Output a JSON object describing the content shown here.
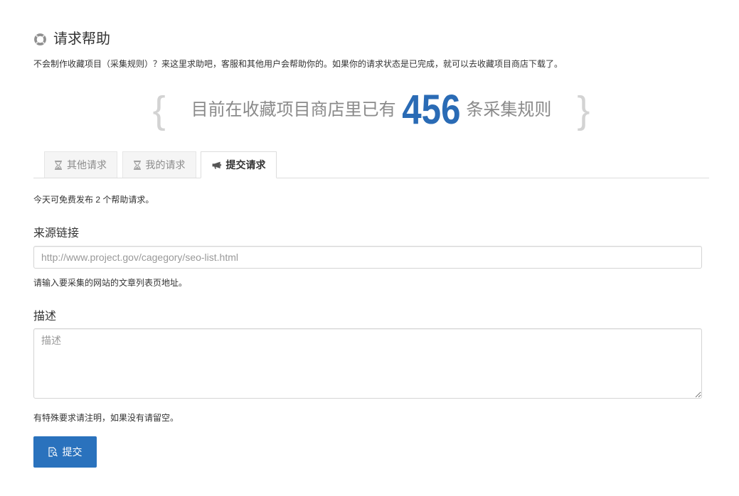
{
  "header": {
    "title": "请求帮助",
    "icon": "lifebuoy-icon",
    "description": "不会制作收藏项目（采集规则）？来这里求助吧，客服和其他用户会帮助你的。如果你的请求状态是已完成，就可以去收藏项目商店下载了。"
  },
  "banner": {
    "open_brace": "{",
    "prefix": "目前在收藏项目商店里已有",
    "count": 456,
    "suffix": "条采集规则",
    "close_brace": "}",
    "count_color": "#2a6bb5"
  },
  "tabs": [
    {
      "label": "其他请求",
      "icon": "hourglass-icon",
      "active": false
    },
    {
      "label": "我的请求",
      "icon": "hourglass-icon",
      "active": false
    },
    {
      "label": "提交请求",
      "icon": "bullhorn-icon",
      "active": true
    }
  ],
  "form": {
    "quota_text": "今天可免费发布 2 个帮助请求。",
    "source_url": {
      "label": "来源链接",
      "placeholder": "http://www.project.gov/cagegory/seo-list.html",
      "help": "请输入要采集的网站的文章列表页地址。"
    },
    "description": {
      "label": "描述",
      "placeholder": "描述",
      "help": "有特殊要求请注明，如果没有请留空。"
    },
    "submit": {
      "label": "提交",
      "icon": "file-search-icon",
      "color": "#2a72bd"
    }
  }
}
